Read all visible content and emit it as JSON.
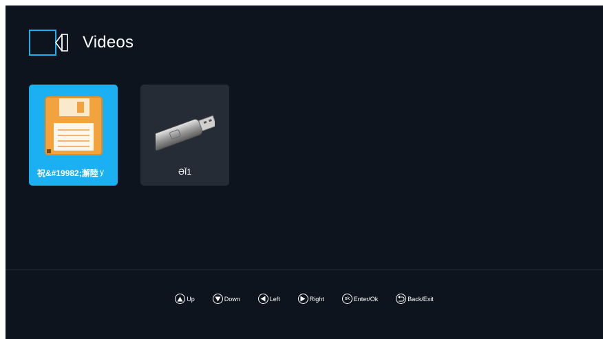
{
  "header": {
    "title": "Videos",
    "icon": "video-camera-icon"
  },
  "sources": [
    {
      "label": "祝&#19982;澥陸",
      "label_suffix": "y",
      "icon": "floppy-disk-icon",
      "selected": true
    },
    {
      "label": "ƏĬ1",
      "icon": "usb-drive-icon",
      "selected": false
    }
  ],
  "hints": [
    {
      "icon": "up-arrow-icon",
      "label": "Up"
    },
    {
      "icon": "down-arrow-icon",
      "label": "Down"
    },
    {
      "icon": "left-arrow-icon",
      "label": "Left"
    },
    {
      "icon": "right-arrow-icon",
      "label": "Right"
    },
    {
      "icon": "ok-icon",
      "icon_text": "ok",
      "label": "Enter/Ok"
    },
    {
      "icon": "back-icon",
      "label": "Back/Exit"
    }
  ],
  "colors": {
    "background": "#0e141e",
    "selected": "#1bb0f2",
    "tile": "#252c35",
    "accent": "#1bb0f2"
  }
}
